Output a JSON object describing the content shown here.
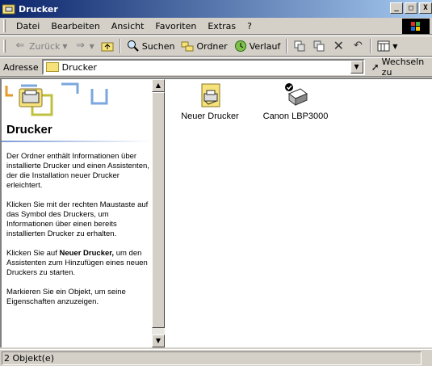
{
  "window": {
    "title": "Drucker",
    "controls": [
      "_",
      "□",
      "X"
    ]
  },
  "menubar": {
    "items": [
      {
        "label": "Datei"
      },
      {
        "label": "Bearbeiten"
      },
      {
        "label": "Ansicht"
      },
      {
        "label": "Favoriten"
      },
      {
        "label": "Extras"
      },
      {
        "label": "?"
      }
    ]
  },
  "toolbar": {
    "back_label": "Zurück",
    "search_label": "Suchen",
    "folders_label": "Ordner",
    "history_label": "Verlauf"
  },
  "addressbar": {
    "label": "Adresse",
    "value": "Drucker",
    "go_label": "Wechseln zu"
  },
  "leftpanel": {
    "title": "Drucker",
    "paragraphs": [
      "Der Ordner enthält Informationen über installierte Drucker und einen Assistenten, der die Installation neuer Drucker erleichtert.",
      "Klicken Sie mit der rechten Maustaste auf das Symbol des Druckers, um Informationen über einen bereits installierten Drucker zu erhalten.",
      "Markieren Sie ein Objekt, um seine Eigenschaften anzuzeigen."
    ],
    "p3_prefix": "Klicken Sie auf ",
    "p3_bold": "Neuer Drucker,",
    "p3_suffix": " um den Assistenten zum Hinzufügen eines neuen Druckers zu starten."
  },
  "items": [
    {
      "label": "Neuer Drucker",
      "icon": "add-printer-icon"
    },
    {
      "label": "Canon LBP3000",
      "icon": "printer-icon"
    }
  ],
  "statusbar": {
    "text": "2 Objekt(e)"
  },
  "colors": {
    "titlebar_start": "#0a246a",
    "titlebar_end": "#a6caf0",
    "chrome": "#d4d0c8"
  }
}
